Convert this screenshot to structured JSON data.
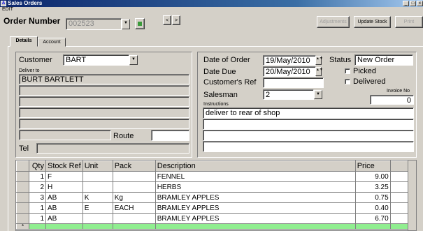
{
  "window": {
    "title": "Sales Orders",
    "mode": "EDIT",
    "buttons": [
      "_",
      "□",
      "x"
    ]
  },
  "header": {
    "order_number_label": "Order Number",
    "order_number_value": "002523",
    "nav_prev": "<",
    "nav_next": ">",
    "adjustments_label": "Adjustments",
    "update_stock_label": "Update Stock",
    "print_label": "Print"
  },
  "tabs": [
    {
      "label": "Details"
    },
    {
      "label": "Account"
    }
  ],
  "customer": {
    "label": "Customer",
    "code": "BART",
    "deliver_to_label": "Deliver to",
    "address_lines": [
      "BURT BARTLETT",
      "",
      "",
      "",
      "",
      ""
    ],
    "route_label": "Route",
    "route_value": "",
    "tel_label": "Tel",
    "tel_value": ""
  },
  "order": {
    "date_of_order_label": "Date of Order",
    "date_of_order": "19/May/2010",
    "date_due_label": "Date Due",
    "date_due": "20/May/2010",
    "customers_ref_label": "Customer's Ref",
    "customers_ref": "",
    "salesman_label": "Salesman",
    "salesman": "2",
    "status_label": "Status",
    "status": "New Order",
    "picked_label": "Picked",
    "picked": false,
    "delivered_label": "Delivered",
    "delivered": false,
    "invoice_no_label": "Invoice No",
    "invoice_no": "0",
    "instructions_label": "Instructions",
    "instructions": [
      "deliver to rear of shop",
      "",
      "",
      ""
    ]
  },
  "grid": {
    "columns": [
      "Qty",
      "Stock Ref",
      "Unit",
      "Pack",
      "Description",
      "Price"
    ],
    "rows": [
      {
        "qty": "1",
        "stock_ref": "F",
        "unit": "",
        "pack": "",
        "description": "FENNEL",
        "price": "9.00"
      },
      {
        "qty": "2",
        "stock_ref": "H",
        "unit": "",
        "pack": "",
        "description": "HERBS",
        "price": "3.25"
      },
      {
        "qty": "3",
        "stock_ref": "AB",
        "unit": "K",
        "pack": "Kg",
        "description": "BRAMLEY APPLES",
        "price": "0.75"
      },
      {
        "qty": "1",
        "stock_ref": "AB",
        "unit": "E",
        "pack": "EACH",
        "description": "BRAMLEY APPLES",
        "price": "0.40"
      },
      {
        "qty": "1",
        "stock_ref": "AB",
        "unit": "",
        "pack": "",
        "description": "BRAMLEY APPLES",
        "price": "6.70"
      }
    ],
    "new_row_marker": "*",
    "colors": {
      "new_row": "#90ee90"
    }
  }
}
